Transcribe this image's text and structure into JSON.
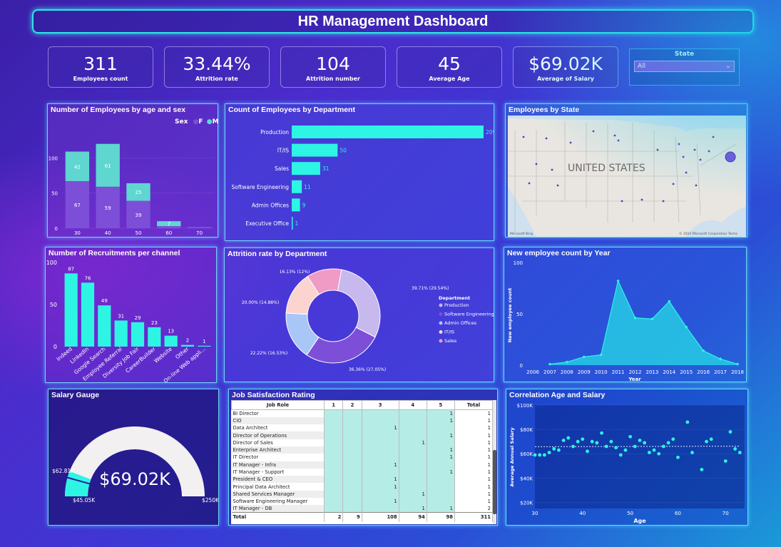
{
  "header": {
    "title": "HR Management Dashboard"
  },
  "kpis": [
    {
      "value": "311",
      "label": "Employees count"
    },
    {
      "value": "33.44%",
      "label": "Attrition rate"
    },
    {
      "value": "104",
      "label": "Attrition number"
    },
    {
      "value": "45",
      "label": "Average Age"
    },
    {
      "value": "$69.02K",
      "label": "Average of Salary"
    }
  ],
  "state_slicer": {
    "title": "State",
    "selected": "All"
  },
  "age_sex_chart": {
    "title": "Number of Employees by age and sex",
    "legend_title": "Sex",
    "legend": [
      "F",
      "M"
    ],
    "colors": {
      "F": "#7d4fd8",
      "M": "#5fd6cf"
    },
    "chart_data": {
      "type": "bar",
      "categories": [
        "30",
        "40",
        "50",
        "60",
        "70"
      ],
      "series": [
        {
          "name": "F",
          "values": [
            67,
            59,
            39,
            3,
            2
          ]
        },
        {
          "name": "M",
          "values": [
            42,
            61,
            25,
            7,
            0
          ]
        }
      ],
      "value_labels": {
        "F": [
          "67",
          "59",
          "39",
          "",
          ""
        ],
        "M": [
          "42",
          "61",
          "25",
          "7",
          ""
        ]
      },
      "yticks": [
        "0",
        "50",
        "100"
      ],
      "ylim": [
        0,
        140
      ]
    }
  },
  "dept_chart": {
    "title": "Count of Employees by Department",
    "color": "#2ef4e4",
    "chart_data": {
      "type": "bar",
      "orientation": "horizontal",
      "categories": [
        "Production",
        "IT/IS",
        "Sales",
        "Software Engineering",
        "Admin Offices",
        "Executive Office"
      ],
      "values": [
        209,
        50,
        31,
        11,
        9,
        1
      ]
    }
  },
  "map_panel": {
    "title": "Employees by State",
    "map_label": "UNITED STATES",
    "attribution_left": "Microsoft Bing",
    "attribution_right": "© 2024 Microsoft Corporation  Terms"
  },
  "recruit_chart": {
    "title": "Number of Recruitments per channel",
    "color": "#2ef4e4",
    "chart_data": {
      "type": "bar",
      "categories": [
        "Indeed",
        "LinkedIn",
        "Google Search",
        "Employee Referral",
        "Diversity Job Fair",
        "CareerBuilder",
        "Website",
        "Other",
        "On-line Web appli..."
      ],
      "values": [
        87,
        76,
        49,
        31,
        29,
        23,
        13,
        2,
        1
      ],
      "yticks": [
        "0",
        "50",
        "100"
      ],
      "ylim": [
        0,
        100
      ]
    }
  },
  "attrition_chart": {
    "title": "Attrition rate by Department",
    "legend_title": "Department",
    "chart_data": {
      "type": "pie",
      "style": "donut",
      "categories": [
        "Production",
        "Software Engineering",
        "Admin Offices",
        "IT/IS",
        "Sales"
      ],
      "values": [
        39.71,
        36.36,
        22.22,
        20.0,
        16.13
      ],
      "labels": [
        "39.71% (29.54%)",
        "36.36% (27.05%)",
        "22.22% (16.53%)",
        "20.00% (14.88%)",
        "16.13% (12%)"
      ],
      "colors": [
        "#c7b8ee",
        "#7d4fd8",
        "#a8c6f6",
        "#fbd3cf",
        "#f09ac6"
      ]
    }
  },
  "newemp_chart": {
    "title": "New employee count by Year",
    "ylabel": "New employee count",
    "xlabel": "Year",
    "chart_data": {
      "type": "area",
      "x": [
        "2006",
        "2007",
        "2008",
        "2009",
        "2010",
        "2011",
        "2012",
        "2013",
        "2014",
        "2015",
        "2016",
        "2017",
        "2018"
      ],
      "values": [
        0,
        1,
        3,
        8,
        10,
        82,
        46,
        45,
        62,
        37,
        14,
        6,
        1
      ],
      "yticks": [
        "0",
        "50",
        "100"
      ],
      "ylim": [
        0,
        100
      ]
    }
  },
  "salary_gauge": {
    "title": "Salary Gauge",
    "value_label": "$69.02K",
    "min_label": "$45.05K",
    "max_label": "$250K",
    "target_label": "$62.81K",
    "value": 69.02,
    "min": 45.05,
    "max": 250,
    "target": 62.81
  },
  "job_satisfaction": {
    "title": "Job Satisfaction Rating",
    "columns": [
      "Job Role",
      "1",
      "2",
      "3",
      "4",
      "5",
      "Total"
    ],
    "rows": [
      [
        "BI Director",
        "",
        "",
        "",
        "",
        "1",
        "1"
      ],
      [
        "CIO",
        "",
        "",
        "",
        "",
        "1",
        "1"
      ],
      [
        "Data Architect",
        "",
        "",
        "1",
        "",
        "",
        "1"
      ],
      [
        "Director of Operations",
        "",
        "",
        "",
        "",
        "1",
        "1"
      ],
      [
        "Director of Sales",
        "",
        "",
        "",
        "1",
        "",
        "1"
      ],
      [
        "Enterprise Architect",
        "",
        "",
        "",
        "",
        "1",
        "1"
      ],
      [
        "IT Director",
        "",
        "",
        "",
        "",
        "1",
        "1"
      ],
      [
        "IT Manager - Infra",
        "",
        "",
        "1",
        "",
        "",
        "1"
      ],
      [
        "IT Manager - Support",
        "",
        "",
        "",
        "",
        "1",
        "1"
      ],
      [
        "President & CEO",
        "",
        "",
        "1",
        "",
        "",
        "1"
      ],
      [
        "Principal Data Architect",
        "",
        "",
        "1",
        "",
        "",
        "1"
      ],
      [
        "Shared Services Manager",
        "",
        "",
        "",
        "1",
        "",
        "1"
      ],
      [
        "Software Engineering Manager",
        "",
        "",
        "1",
        "",
        "",
        "1"
      ],
      [
        "IT Manager - DB",
        "",
        "",
        "",
        "1",
        "1",
        "2"
      ]
    ],
    "totals": [
      "Total",
      "2",
      "9",
      "108",
      "94",
      "98",
      "311"
    ]
  },
  "corr_chart": {
    "title": "Correlation Age and Salary",
    "xlabel": "Age",
    "ylabel": "Average Annual Salary",
    "chart_data": {
      "type": "scatter",
      "x": [
        30,
        31,
        32,
        33,
        34,
        35,
        36,
        37,
        38,
        39,
        40,
        41,
        42,
        43,
        44,
        45,
        46,
        47,
        48,
        49,
        50,
        51,
        52,
        53,
        54,
        55,
        56,
        57,
        58,
        59,
        60,
        62,
        63,
        65,
        66,
        67,
        70,
        71,
        72,
        73
      ],
      "y": [
        59,
        59,
        59,
        61,
        64,
        63,
        71,
        73,
        66,
        70,
        72,
        62,
        70,
        69,
        77,
        66,
        70,
        65,
        59,
        63,
        74,
        66,
        71,
        69,
        61,
        63,
        60,
        66,
        69,
        72,
        57,
        86,
        61,
        47,
        70,
        72,
        54,
        78,
        64,
        61
      ],
      "xticks": [
        "30",
        "40",
        "50",
        "60",
        "70"
      ],
      "yticks": [
        "$20K",
        "$40K",
        "$60K",
        "$80K",
        "$100K"
      ],
      "xlim": [
        30,
        74
      ],
      "ylim": [
        15,
        100
      ]
    }
  }
}
